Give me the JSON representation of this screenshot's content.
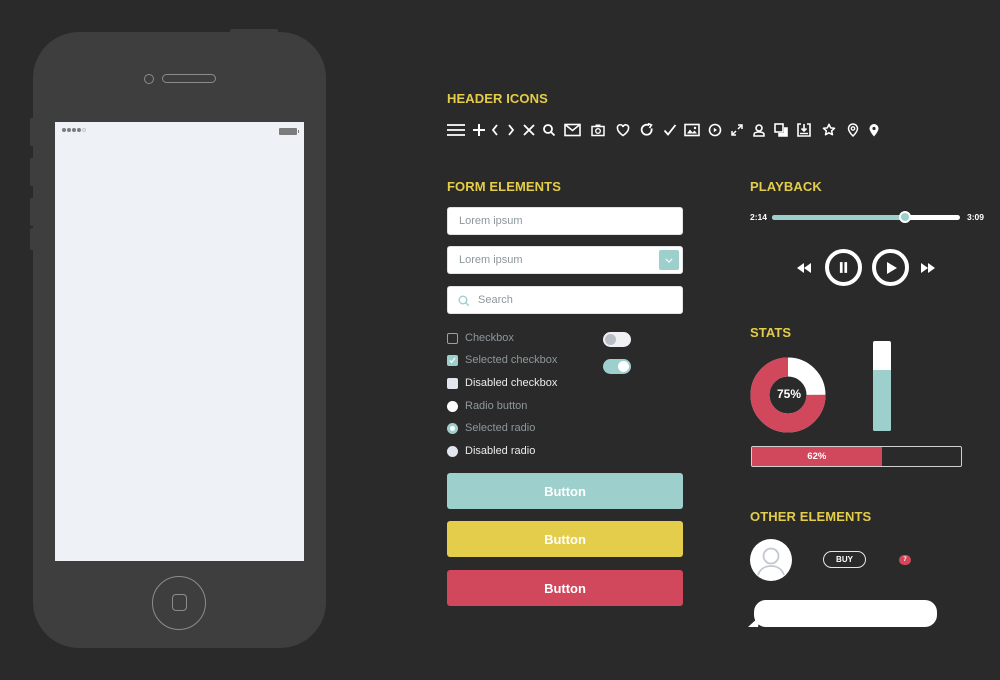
{
  "colors": {
    "background": "#2a2a2a",
    "accent_yellow": "#e4cd4a",
    "teal": "#9dd0cd",
    "red": "#d1475c",
    "phone_body": "#3d3e3d",
    "screen": "#eef2f6"
  },
  "phone": {
    "signal_bars": 4,
    "signal_total": 5
  },
  "header_icons": {
    "title": "HEADER ICONS",
    "icons": [
      "menu-icon",
      "plus-icon",
      "chevron-left-icon",
      "chevron-right-icon",
      "close-icon",
      "search-icon",
      "mail-icon",
      "camera-icon",
      "heart-icon",
      "refresh-icon",
      "check-icon",
      "image-icon",
      "play-circle-icon",
      "expand-icon",
      "user-icon",
      "copy-icon",
      "download-icon",
      "star-icon",
      "location-outline-icon",
      "location-pin-icon"
    ]
  },
  "form": {
    "title": "FORM ELEMENTS",
    "text_input": {
      "placeholder": "Lorem ipsum",
      "value": ""
    },
    "select": {
      "selected": "Lorem ipsum"
    },
    "search": {
      "placeholder": "Search",
      "value": ""
    },
    "options": [
      {
        "type": "checkbox",
        "label": "Checkbox",
        "state": "unchecked"
      },
      {
        "type": "checkbox",
        "label": "Selected checkbox",
        "state": "checked"
      },
      {
        "type": "checkbox",
        "label": "Disabled checkbox",
        "state": "disabled"
      },
      {
        "type": "radio",
        "label": "Radio button",
        "state": "unchecked"
      },
      {
        "type": "radio",
        "label": "Selected radio",
        "state": "checked"
      },
      {
        "type": "radio",
        "label": "Disabled radio",
        "state": "disabled"
      }
    ],
    "toggles": [
      {
        "state": "off"
      },
      {
        "state": "on"
      }
    ],
    "buttons": [
      {
        "label": "Button",
        "color": "#9dd0cd"
      },
      {
        "label": "Button",
        "color": "#e4cd4a"
      },
      {
        "label": "Button",
        "color": "#d1475c"
      }
    ]
  },
  "playback": {
    "title": "PLAYBACK",
    "elapsed": "2:14",
    "duration": "3:09",
    "progress": 0.71,
    "controls": [
      "rewind",
      "pause",
      "play",
      "fast-forward"
    ]
  },
  "stats": {
    "title": "STATS",
    "donut_percent": 75,
    "donut_label": "75%",
    "vertical_bar_percent": 68,
    "horizontal_bar_percent": 62,
    "horizontal_bar_label": "62%"
  },
  "other": {
    "title": "OTHER ELEMENTS",
    "buy_label": "BUY",
    "badge_count": "7",
    "bubble_text": ""
  }
}
